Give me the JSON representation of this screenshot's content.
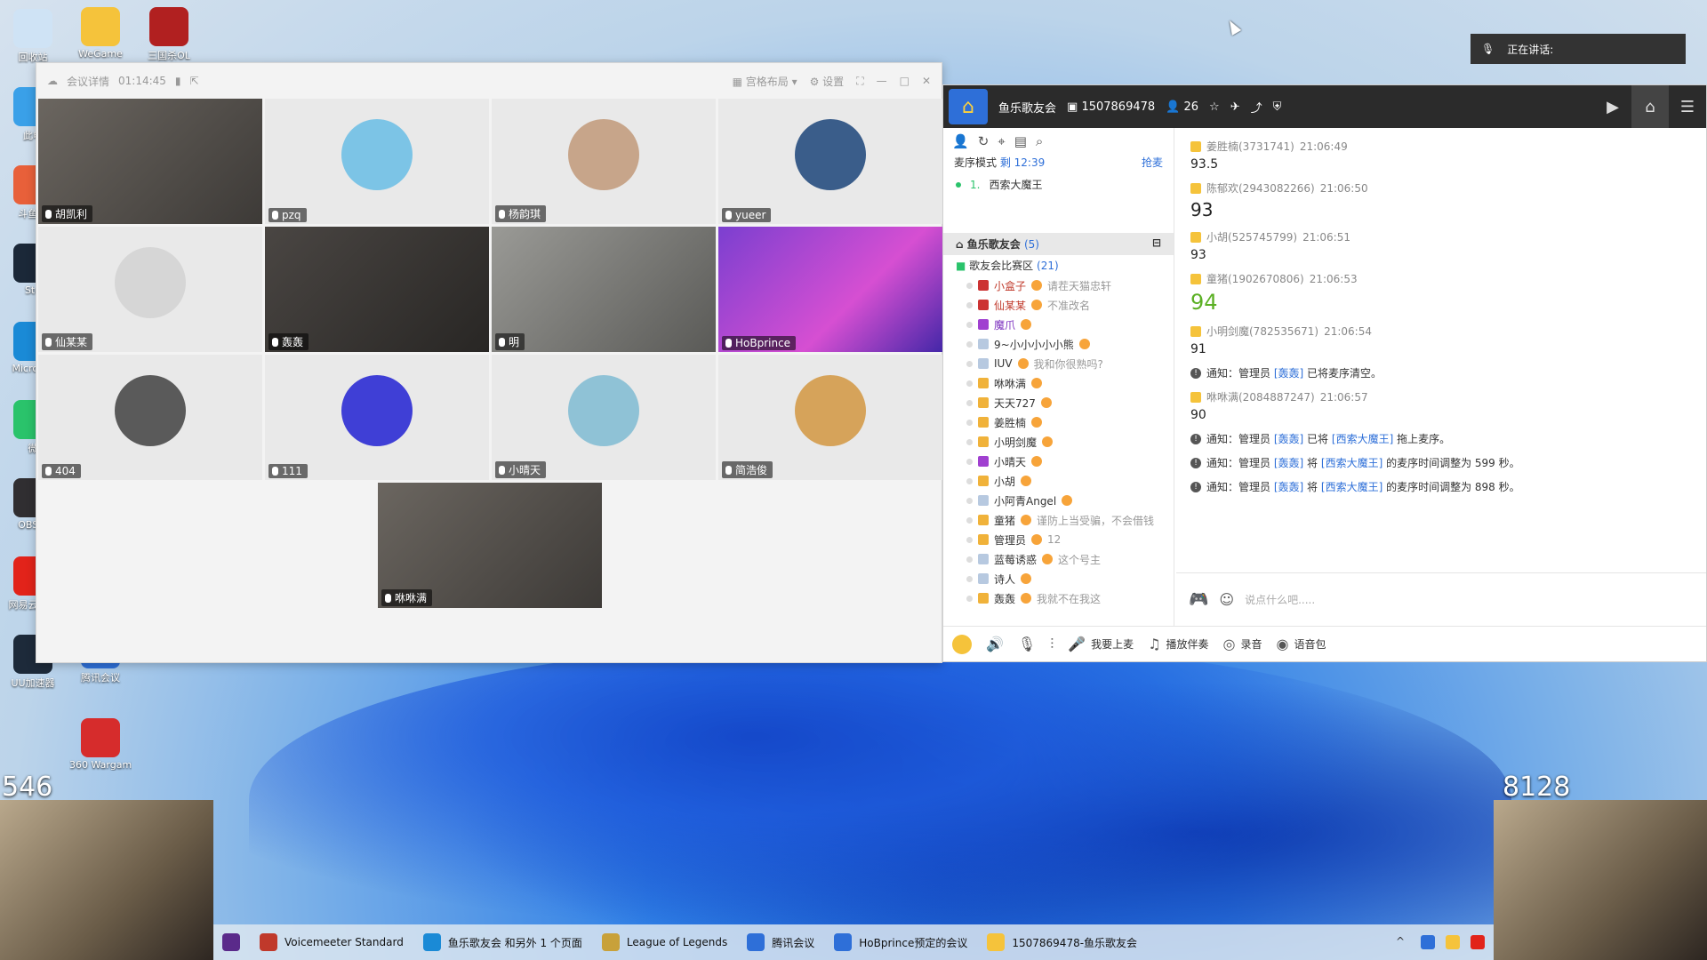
{
  "desktop": {
    "icons_left": [
      {
        "label": "回收站",
        "color": "#cfe3f5"
      },
      {
        "label": "此电",
        "color": "#3aa0e8"
      },
      {
        "label": "斗鱼直",
        "color": "#e8603a"
      },
      {
        "label": "Ste",
        "color": "#1b2838"
      },
      {
        "label": "Micro Ed",
        "color": "#1a8ad6"
      },
      {
        "label": "微",
        "color": "#2ac36b"
      },
      {
        "label": "OBS S",
        "color": "#302e31"
      },
      {
        "label": "网易云音乐",
        "color": "#e2231a"
      },
      {
        "label": "UU加速器",
        "color": "#1d2a3a"
      }
    ],
    "icons_col2": [
      {
        "label": "WeGame",
        "color": "#f5c33b"
      },
      {
        "label": "三国杀OL",
        "color": "#b12020"
      },
      {
        "label": "腾讯会议",
        "color": "#2e6fd8"
      },
      {
        "label": "360 Wargami...",
        "color": "#d62c2c"
      }
    ]
  },
  "meeting": {
    "title": "会议详情",
    "duration": "01:14:45",
    "layout_label": "宫格布局",
    "settings_label": "设置",
    "tiles": [
      {
        "name": "胡凯利",
        "kind": "video"
      },
      {
        "name": "pzq",
        "kind": "avatar",
        "color": "#7cc4e6"
      },
      {
        "name": "杨韵琪",
        "kind": "avatar",
        "color": "#c7a58a"
      },
      {
        "name": "yueer",
        "kind": "avatar",
        "color": "#3a5d8a"
      },
      {
        "name": "仙某某",
        "kind": "avatar",
        "color": "#d6d6d6"
      },
      {
        "name": "轰轰",
        "kind": "video2"
      },
      {
        "name": "明",
        "kind": "video3"
      },
      {
        "name": "HoBprince",
        "kind": "stream"
      },
      {
        "name": "404",
        "kind": "avatar",
        "color": "#5a5a5a"
      },
      {
        "name": "111",
        "kind": "avatar",
        "color": "#3f3fd6"
      },
      {
        "name": "小晴天",
        "kind": "avatar",
        "color": "#8fc2d6"
      },
      {
        "name": "简浩俊",
        "kind": "avatar",
        "color": "#d6a35a"
      }
    ],
    "last_tile": {
      "name": "咻咻满",
      "kind": "video"
    }
  },
  "yy": {
    "room_name": "鱼乐歌友会",
    "room_id": "1507869478",
    "online_count": "26",
    "mic_mode_label": "麦序模式",
    "mic_time": "剩 12:39",
    "grab_label": "抢麦",
    "queue_index": "1.",
    "queue_name": "西索大魔王",
    "channel_name": "鱼乐歌友会",
    "channel_count": "(5)",
    "subchannel_name": "歌友会比赛区",
    "subchannel_count": "(21)",
    "members": [
      {
        "name": "小盒子",
        "sig": "请茬天猫忠轩",
        "style": "red",
        "role": "r3"
      },
      {
        "name": "仙某某",
        "sig": "不准改名",
        "style": "red",
        "role": "r3"
      },
      {
        "name": "魔爪",
        "sig": "",
        "style": "purple",
        "role": "r4"
      },
      {
        "name": "9~小小小小小熊",
        "sig": "",
        "style": "",
        "role": "r2"
      },
      {
        "name": "IUV",
        "sig": "我和你很熟吗?",
        "style": "",
        "role": "r2"
      },
      {
        "name": "咻咻满",
        "sig": "",
        "style": "",
        "role": ""
      },
      {
        "name": "天天727",
        "sig": "",
        "style": "",
        "role": ""
      },
      {
        "name": "姜胜楠",
        "sig": "",
        "style": "",
        "role": ""
      },
      {
        "name": "小明剑魔",
        "sig": "",
        "style": "",
        "role": ""
      },
      {
        "name": "小晴天",
        "sig": "",
        "style": "",
        "role": "r4"
      },
      {
        "name": "小胡",
        "sig": "",
        "style": "",
        "role": ""
      },
      {
        "name": "小阿青Angel",
        "sig": "",
        "style": "",
        "role": "r2"
      },
      {
        "name": "童猪",
        "sig": "谨防上当受骗，不会借钱",
        "style": "",
        "role": ""
      },
      {
        "name": "管理员",
        "sig": "12",
        "style": "",
        "role": ""
      },
      {
        "name": "蓝莓诱惑",
        "sig": "这个号主",
        "style": "",
        "role": "r2"
      },
      {
        "name": "诗人",
        "sig": "",
        "style": "",
        "role": "r2"
      },
      {
        "name": "轰轰",
        "sig": "我就不在我这",
        "style": "",
        "role": ""
      }
    ],
    "messages": [
      {
        "type": "msg",
        "who": "姜胜楠(3731741)",
        "time": "21:06:49",
        "text": "93.5",
        "size": "normal"
      },
      {
        "type": "msg",
        "who": "陈郁欢(2943082266)",
        "time": "21:06:50",
        "text": "93",
        "size": "big"
      },
      {
        "type": "msg",
        "who": "小胡(525745799)",
        "time": "21:06:51",
        "text": "93",
        "size": "normal"
      },
      {
        "type": "msg",
        "who": "童猪(1902670806)",
        "time": "21:06:53",
        "text": "94",
        "size": "green"
      },
      {
        "type": "msg",
        "who": "小明剑魔(782535671)",
        "time": "21:06:54",
        "text": "91",
        "size": "normal"
      },
      {
        "type": "notice",
        "pre": "通知：管理员",
        "hl1": "[轰轰]",
        "mid": "已将麦序清空。",
        "hl2": "",
        "post": ""
      },
      {
        "type": "msg",
        "who": "咻咻满(2084887247)",
        "time": "21:06:57",
        "text": "90",
        "size": "normal"
      },
      {
        "type": "notice",
        "pre": "通知：管理员",
        "hl1": "[轰轰]",
        "mid": "已将",
        "hl2": "[西索大魔王]",
        "post": "拖上麦序。"
      },
      {
        "type": "notice",
        "pre": "通知：管理员",
        "hl1": "[轰轰]",
        "mid": "将",
        "hl2": "[西索大魔王]",
        "post": "的麦序时间调整为 599 秒。"
      },
      {
        "type": "notice",
        "pre": "通知：管理员",
        "hl1": "[轰轰]",
        "mid": "将",
        "hl2": "[西索大魔王]",
        "post": "的麦序时间调整为 898 秒。"
      }
    ],
    "input_placeholder": "说点什么吧.....",
    "bottom": {
      "want_mic": "我要上麦",
      "play_bgm": "播放伴奏",
      "record": "录音",
      "voice_pack": "语音包"
    }
  },
  "speaking": {
    "label": "正在讲话:"
  },
  "overlays": {
    "left_count": "546",
    "right_count": "8128"
  },
  "taskbar": {
    "items": [
      {
        "label": "Voicemeeter Standard",
        "color": "#c0392b"
      },
      {
        "label": "鱼乐歌友会 和另外 1 个页面",
        "color": "#1a8ad6"
      },
      {
        "label": "League of Legends",
        "color": "#c8a13a"
      },
      {
        "label": "腾讯会议",
        "color": "#2e6fd8"
      },
      {
        "label": "HoBprince预定的会议",
        "color": "#2e6fd8"
      },
      {
        "label": "1507869478-鱼乐歌友会",
        "color": "#f5c33b"
      }
    ]
  }
}
